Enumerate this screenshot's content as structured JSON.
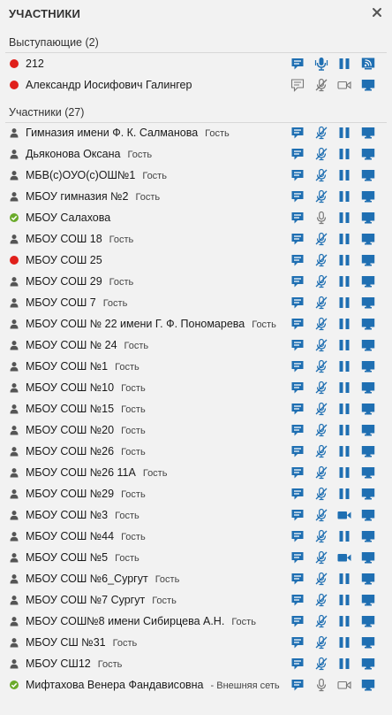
{
  "panel": {
    "title": "УЧАСТНИКИ",
    "close_glyph": "×"
  },
  "colors": {
    "accent": "#1f6fb2",
    "status_red": "#e0201b",
    "status_green": "#6aaa2a",
    "status_gray": "#555555",
    "icon_gray": "#777777"
  },
  "speakers": {
    "title": "Выступающие (2)",
    "rows": [
      {
        "name": "212",
        "tag": "",
        "status": "red",
        "icons": [
          "chat-active",
          "mic-active",
          "pause",
          "stream"
        ]
      },
      {
        "name": "Александр Иосифович Галингер",
        "tag": "",
        "status": "red",
        "icons": [
          "chat-outline",
          "mic-off-gray",
          "camera-gray",
          "screen"
        ]
      }
    ]
  },
  "participants": {
    "title": "Участники (27)",
    "rows": [
      {
        "name": "Гимназия имени Ф. К. Салманова",
        "tag": "Гость",
        "status": "person",
        "icons": [
          "chat",
          "mic-off",
          "pause",
          "screen"
        ]
      },
      {
        "name": "Дьяконова Оксана",
        "tag": "Гость",
        "status": "person",
        "icons": [
          "chat",
          "mic-off",
          "pause",
          "screen"
        ]
      },
      {
        "name": "МБВ(с)ОУО(с)ОШ№1",
        "tag": "Гость",
        "status": "person",
        "icons": [
          "chat",
          "mic-off",
          "pause",
          "screen"
        ]
      },
      {
        "name": "МБОУ гимназия №2",
        "tag": "Гость",
        "status": "person",
        "icons": [
          "chat",
          "mic-off",
          "pause",
          "screen"
        ]
      },
      {
        "name": "МБОУ Салахова",
        "tag": "",
        "status": "green",
        "icons": [
          "chat",
          "mic-gray",
          "pause",
          "screen"
        ]
      },
      {
        "name": "МБОУ СОШ 18",
        "tag": "Гость",
        "status": "person",
        "icons": [
          "chat",
          "mic-off",
          "pause",
          "screen"
        ]
      },
      {
        "name": "МБОУ СОШ 25",
        "tag": "",
        "status": "red",
        "icons": [
          "chat",
          "mic-off",
          "pause",
          "screen"
        ]
      },
      {
        "name": "МБОУ СОШ 29",
        "tag": "Гость",
        "status": "person",
        "icons": [
          "chat",
          "mic-off",
          "pause",
          "screen"
        ]
      },
      {
        "name": "МБОУ СОШ 7",
        "tag": "Гость",
        "status": "person",
        "icons": [
          "chat",
          "mic-off",
          "pause",
          "screen"
        ]
      },
      {
        "name": "МБОУ СОШ № 22 имени Г. Ф. Пономарева",
        "tag": "Гость",
        "status": "person",
        "icons": [
          "chat",
          "mic-off",
          "pause",
          "screen"
        ]
      },
      {
        "name": "МБОУ СОШ № 24",
        "tag": "Гость",
        "status": "person",
        "icons": [
          "chat",
          "mic-off",
          "pause",
          "screen"
        ]
      },
      {
        "name": "МБОУ СОШ №1",
        "tag": "Гость",
        "status": "person",
        "icons": [
          "chat",
          "mic-off",
          "pause",
          "screen"
        ]
      },
      {
        "name": "МБОУ СОШ №10",
        "tag": "Гость",
        "status": "person",
        "icons": [
          "chat",
          "mic-off",
          "pause",
          "screen"
        ]
      },
      {
        "name": "МБОУ СОШ №15",
        "tag": "Гость",
        "status": "person",
        "icons": [
          "chat",
          "mic-off",
          "pause",
          "screen"
        ]
      },
      {
        "name": "МБОУ СОШ №20",
        "tag": "Гость",
        "status": "person",
        "icons": [
          "chat",
          "mic-off",
          "pause",
          "screen"
        ]
      },
      {
        "name": "МБОУ СОШ №26",
        "tag": "Гость",
        "status": "person",
        "icons": [
          "chat",
          "mic-off",
          "pause",
          "screen"
        ]
      },
      {
        "name": "МБОУ СОШ №26 11А",
        "tag": "Гость",
        "status": "person",
        "icons": [
          "chat",
          "mic-off",
          "pause",
          "screen"
        ]
      },
      {
        "name": "МБОУ СОШ №29",
        "tag": "Гость",
        "status": "person",
        "icons": [
          "chat",
          "mic-off",
          "pause",
          "screen"
        ]
      },
      {
        "name": "МБОУ СОШ №3",
        "tag": "Гость",
        "status": "person",
        "icons": [
          "chat",
          "mic-off",
          "camera",
          "screen"
        ]
      },
      {
        "name": "МБОУ СОШ №44",
        "tag": "Гость",
        "status": "person",
        "icons": [
          "chat",
          "mic-off",
          "pause",
          "screen"
        ]
      },
      {
        "name": "МБОУ СОШ №5",
        "tag": "Гость",
        "status": "person",
        "icons": [
          "chat",
          "mic-off",
          "camera",
          "screen"
        ]
      },
      {
        "name": "МБОУ СОШ №6_Сургут",
        "tag": "Гость",
        "status": "person",
        "icons": [
          "chat",
          "mic-off",
          "pause",
          "screen"
        ]
      },
      {
        "name": "МБОУ СОШ №7 Сургут",
        "tag": "Гость",
        "status": "person",
        "icons": [
          "chat",
          "mic-off",
          "pause",
          "screen"
        ]
      },
      {
        "name": "МБОУ СОШ№8 имени Сибирцева А.Н.",
        "tag": "Гость",
        "status": "person",
        "icons": [
          "chat",
          "mic-off",
          "pause",
          "screen"
        ]
      },
      {
        "name": "МБОУ СШ №31",
        "tag": "Гость",
        "status": "person",
        "icons": [
          "chat",
          "mic-off",
          "pause",
          "screen"
        ]
      },
      {
        "name": "МБОУ СШ12",
        "tag": "Гость",
        "status": "person",
        "icons": [
          "chat",
          "mic-off",
          "pause",
          "screen"
        ]
      },
      {
        "name": "Мифтахова Венера Фандависовна",
        "tag": "- Внешняя сеть",
        "status": "green",
        "icons": [
          "chat",
          "mic-gray",
          "camera-gray",
          "screen"
        ]
      }
    ]
  }
}
